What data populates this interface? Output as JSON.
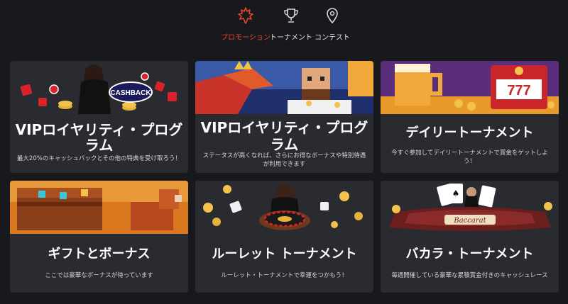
{
  "tabs": [
    {
      "label": "プロモーション",
      "icon": "maple-leaf-icon",
      "active": true
    },
    {
      "label": "トーナメント",
      "icon": "trophy-icon",
      "active": false
    },
    {
      "label": "コンテスト",
      "icon": "map-pin-icon",
      "active": false
    }
  ],
  "colors": {
    "accent": "#e8452f",
    "background": "#18191d",
    "card": "#2a2b31"
  },
  "cards": [
    {
      "title": "VIPロイヤリティ・プログラム",
      "description": "最大20%のキャッシュバックとその他の特典を受け取ろう！",
      "badge": "CASHBACK"
    },
    {
      "title": "VIPロイヤリティ・プログラム",
      "description": "ステータスが高くなれば、さらにお得なボーナスや特別待遇が利用できます"
    },
    {
      "title": "デイリートーナメント",
      "description": "今すぐ参加してデイリートーナメントで賞金をゲットしよう！",
      "slot": "777"
    },
    {
      "title": "ギフトとボーナス",
      "description": "ここでは豪華なボーナスが待っています"
    },
    {
      "title": "ルーレット トーナメント",
      "description": "ルーレット・トーナメントで幸運をつかもう！"
    },
    {
      "title": "バカラ・トーナメント",
      "description": "毎週開催している豪華な累積賞金付きのキャッシュレース",
      "badge": "Baccarat"
    }
  ]
}
